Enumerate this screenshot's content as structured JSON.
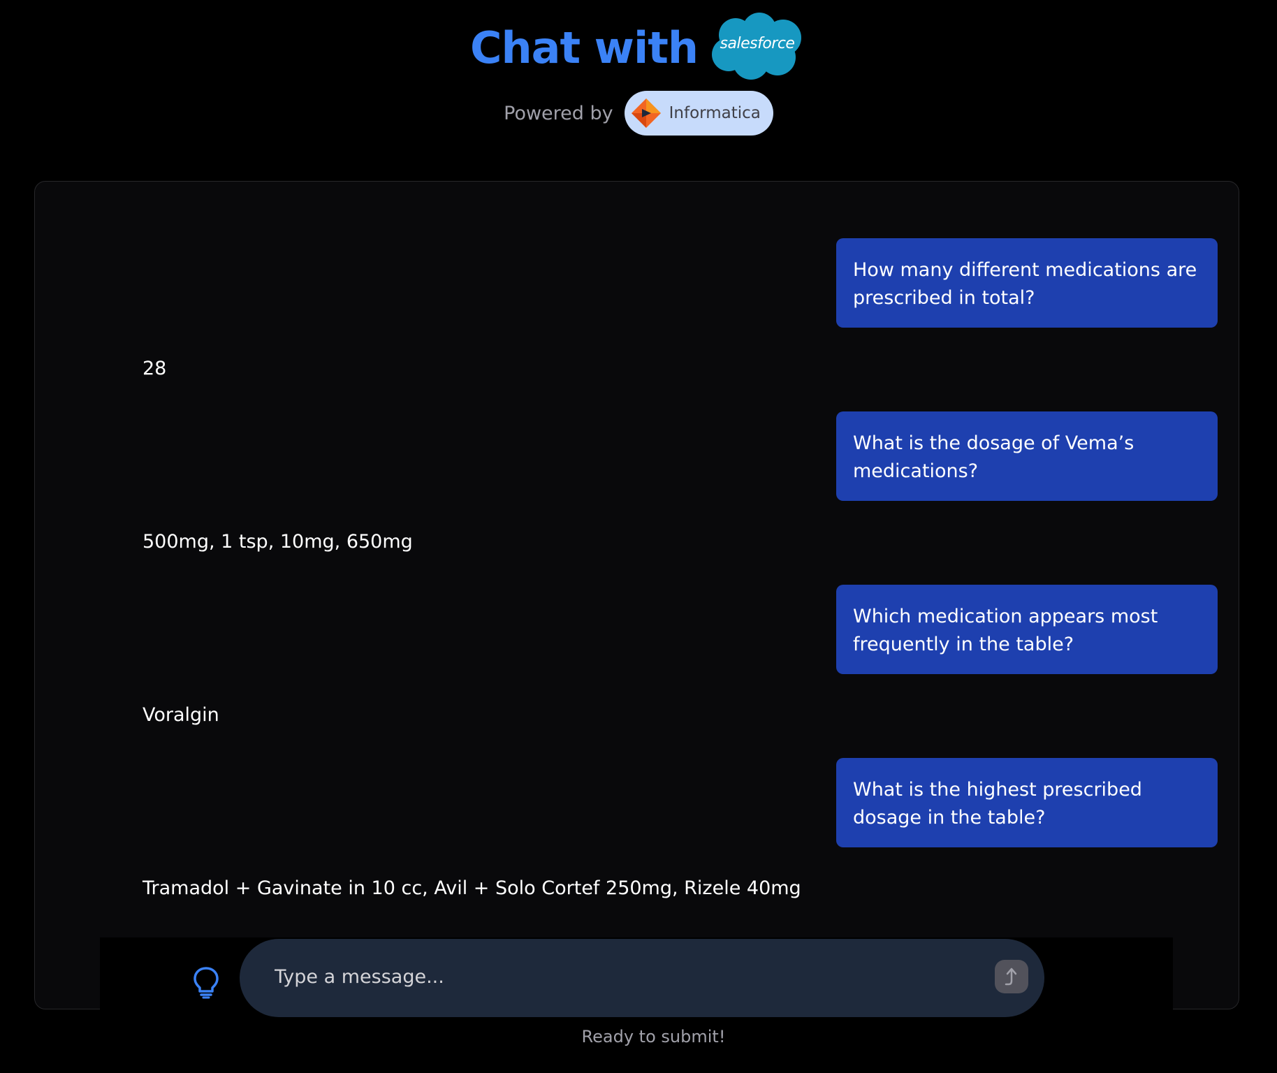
{
  "header": {
    "title": "Chat with",
    "brand_logo_text": "salesforce",
    "powered_by": "Powered by",
    "partner_logo_text": "Informatica"
  },
  "colors": {
    "accent": "#3b82f6",
    "user_bubble": "#1e40af",
    "panel_bg": "#09090b",
    "input_bg": "#1e293b",
    "salesforce_blue": "#1798c1",
    "informatica_orange": "#f26522"
  },
  "icons": {
    "brand": "salesforce-cloud-logo",
    "partner": "informatica-diamond-logo",
    "suggest": "lightbulb-icon",
    "send": "arrow-up-icon"
  },
  "messages": [
    {
      "role": "user",
      "text": "How many different medications are prescribed in total?"
    },
    {
      "role": "assistant",
      "text": "28"
    },
    {
      "role": "user",
      "text": "What is the dosage of Vema’s medications?"
    },
    {
      "role": "assistant",
      "text": "500mg, 1 tsp, 10mg, 650mg"
    },
    {
      "role": "user",
      "text": "Which medication appears most frequently in the table?"
    },
    {
      "role": "assistant",
      "text": "Voralgin"
    },
    {
      "role": "user",
      "text": "What is the highest prescribed dosage in the table?"
    },
    {
      "role": "assistant",
      "text": "Tramadol + Gavinate in 10 cc, Avil + Solo Cortef 250mg, Rizele 40mg"
    }
  ],
  "input": {
    "placeholder": "Type a message...",
    "value": ""
  },
  "status": "Ready to submit!"
}
